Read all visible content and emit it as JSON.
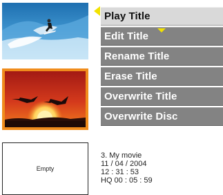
{
  "thumbnails": {
    "empty_label": "Empty"
  },
  "menu": {
    "items": [
      {
        "label": "Play Title",
        "selected": true
      },
      {
        "label": "Edit Title"
      },
      {
        "label": "Rename Title"
      },
      {
        "label": "Erase Title"
      },
      {
        "label": "Overwrite Title"
      },
      {
        "label": "Overwrite Disc"
      }
    ]
  },
  "info": {
    "title": "3. My movie",
    "date": "11 / 04 / 2004",
    "time": "12 : 31 : 53",
    "quality": "HQ 00 : 05 : 59"
  },
  "colors": {
    "selected_frame": "#f08c1c",
    "pointer": "#f2e200",
    "menu_item": "#838383",
    "menu_selected": "#d9d9d9"
  }
}
